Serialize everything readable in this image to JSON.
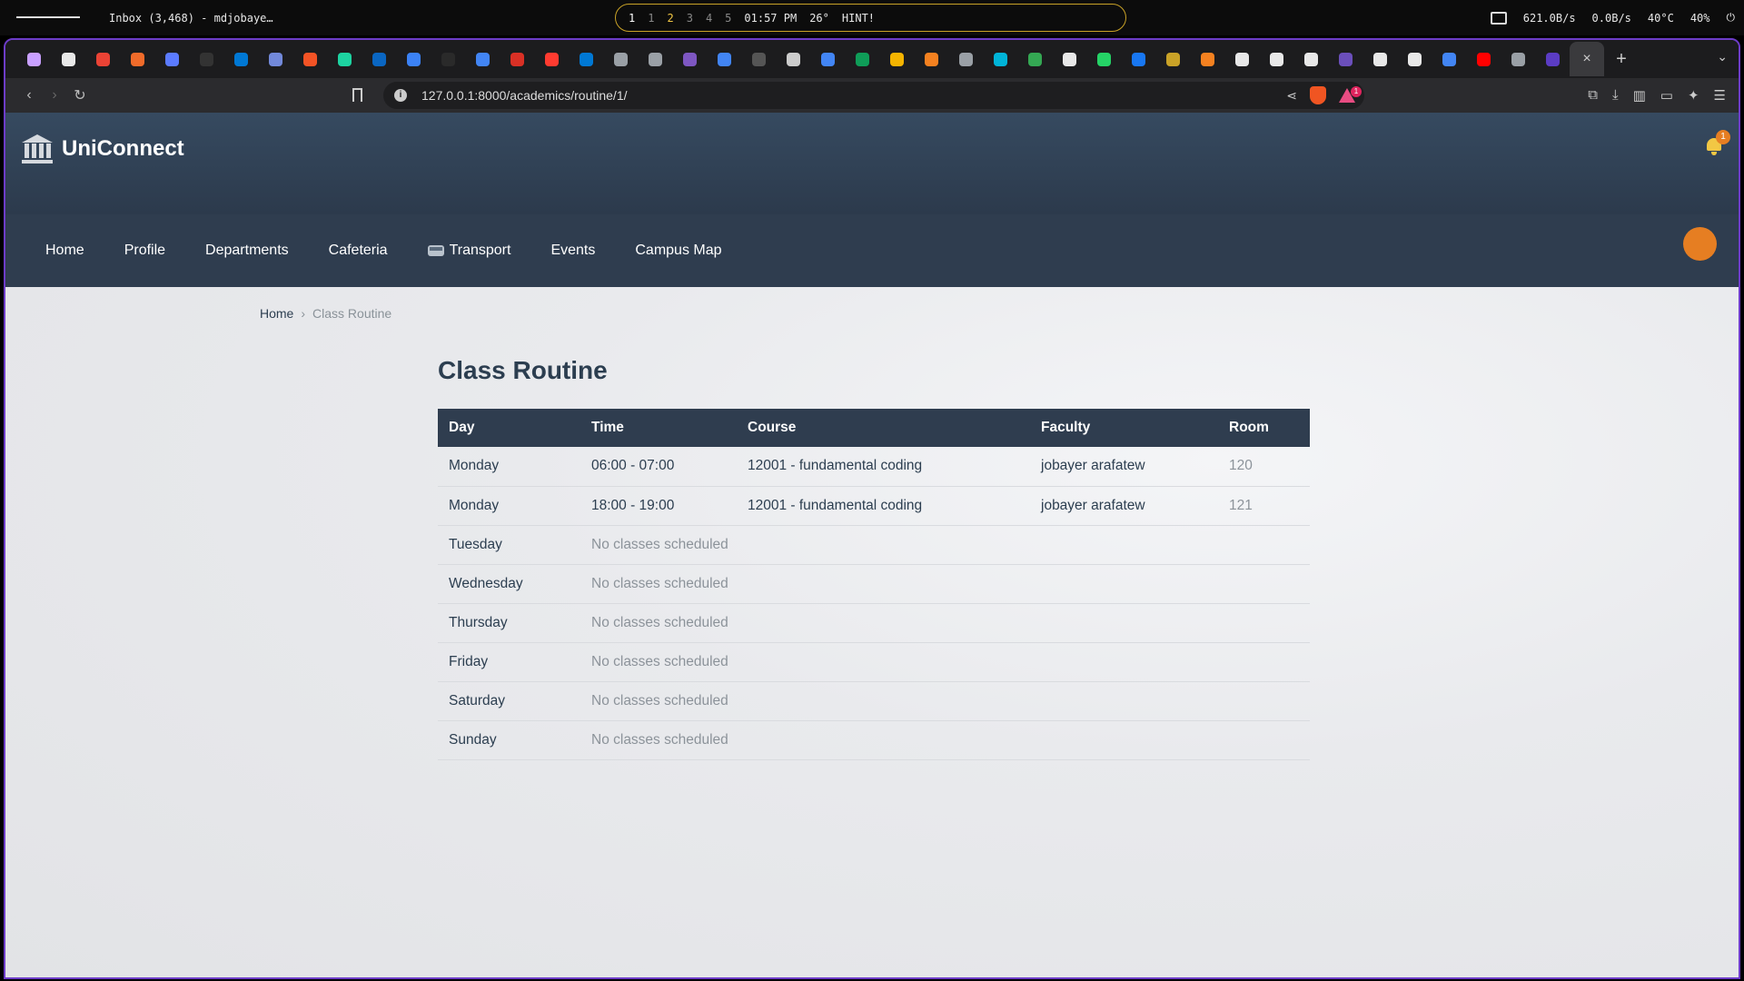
{
  "system_bar": {
    "window_title": "Inbox (3,468) - mdjobaye…",
    "workspaces": [
      "1",
      "1",
      "2",
      "3",
      "4",
      "5"
    ],
    "clock": "01:57 PM",
    "weather": "26°",
    "hint": "HINT!",
    "net_down": "621.0B/s",
    "net_up": "0.0B/s",
    "cpu_temp": "40°C",
    "volume": "40%"
  },
  "browser": {
    "url": "127.0.0.1:8000/academics/routine/1/",
    "rewards_badge": "1",
    "tab_colors": [
      "#c9a0ff",
      "#e8e8e8",
      "#ea4335",
      "#f06b2a",
      "#5b7bff",
      "#333333",
      "#0078d4",
      "#7289da",
      "#f35325",
      "#1dd3a1",
      "#0a66c2",
      "#3b82f6",
      "#2a2a2a",
      "#4285f4",
      "#d93025",
      "#ff3b30",
      "#0078d4",
      "#9aa0a6",
      "#9aa0a6",
      "#7e57c2",
      "#4285f4",
      "#555555",
      "#cccccc",
      "#4285f4",
      "#0f9d58",
      "#f4b400",
      "#f48120",
      "#9aa0a6",
      "#00b4d8",
      "#34a853",
      "#e8e8e8",
      "#25d366",
      "#1877f2",
      "#c9a227",
      "#f48120",
      "#e8e8e8",
      "#e8e8e8",
      "#e8e8e8",
      "#6b4fbb",
      "#e8e8e8",
      "#e8e8e8",
      "#4285f4",
      "#ff0000",
      "#9aa0a6",
      "#5b3cc4"
    ]
  },
  "app": {
    "brand": "UniConnect",
    "notification_count": "1",
    "nav": [
      {
        "label": "Home"
      },
      {
        "label": "Profile"
      },
      {
        "label": "Departments"
      },
      {
        "label": "Cafeteria"
      },
      {
        "label": "Transport"
      },
      {
        "label": "Events"
      },
      {
        "label": "Campus Map"
      }
    ]
  },
  "breadcrumb": {
    "home": "Home",
    "separator": "›",
    "current": "Class Routine"
  },
  "page": {
    "title": "Class Routine",
    "columns": [
      "Day",
      "Time",
      "Course",
      "Faculty",
      "Room"
    ],
    "rows": [
      {
        "day": "Monday",
        "time": "06:00 - 07:00",
        "course": "12001 - fundamental coding",
        "faculty": "jobayer arafatew",
        "room": "120"
      },
      {
        "day": "Monday",
        "time": "18:00 - 19:00",
        "course": "12001 - fundamental coding",
        "faculty": "jobayer arafatew",
        "room": "121"
      },
      {
        "day": "Tuesday",
        "time": "No classes scheduled",
        "course": "",
        "faculty": "",
        "room": ""
      },
      {
        "day": "Wednesday",
        "time": "No classes scheduled",
        "course": "",
        "faculty": "",
        "room": ""
      },
      {
        "day": "Thursday",
        "time": "No classes scheduled",
        "course": "",
        "faculty": "",
        "room": ""
      },
      {
        "day": "Friday",
        "time": "No classes scheduled",
        "course": "",
        "faculty": "",
        "room": ""
      },
      {
        "day": "Saturday",
        "time": "No classes scheduled",
        "course": "",
        "faculty": "",
        "room": ""
      },
      {
        "day": "Sunday",
        "time": "No classes scheduled",
        "course": "",
        "faculty": "",
        "room": ""
      }
    ]
  },
  "colors": {
    "header_bg": "#2f3d4f",
    "accent": "#e67e22",
    "text": "#2c3e50"
  }
}
